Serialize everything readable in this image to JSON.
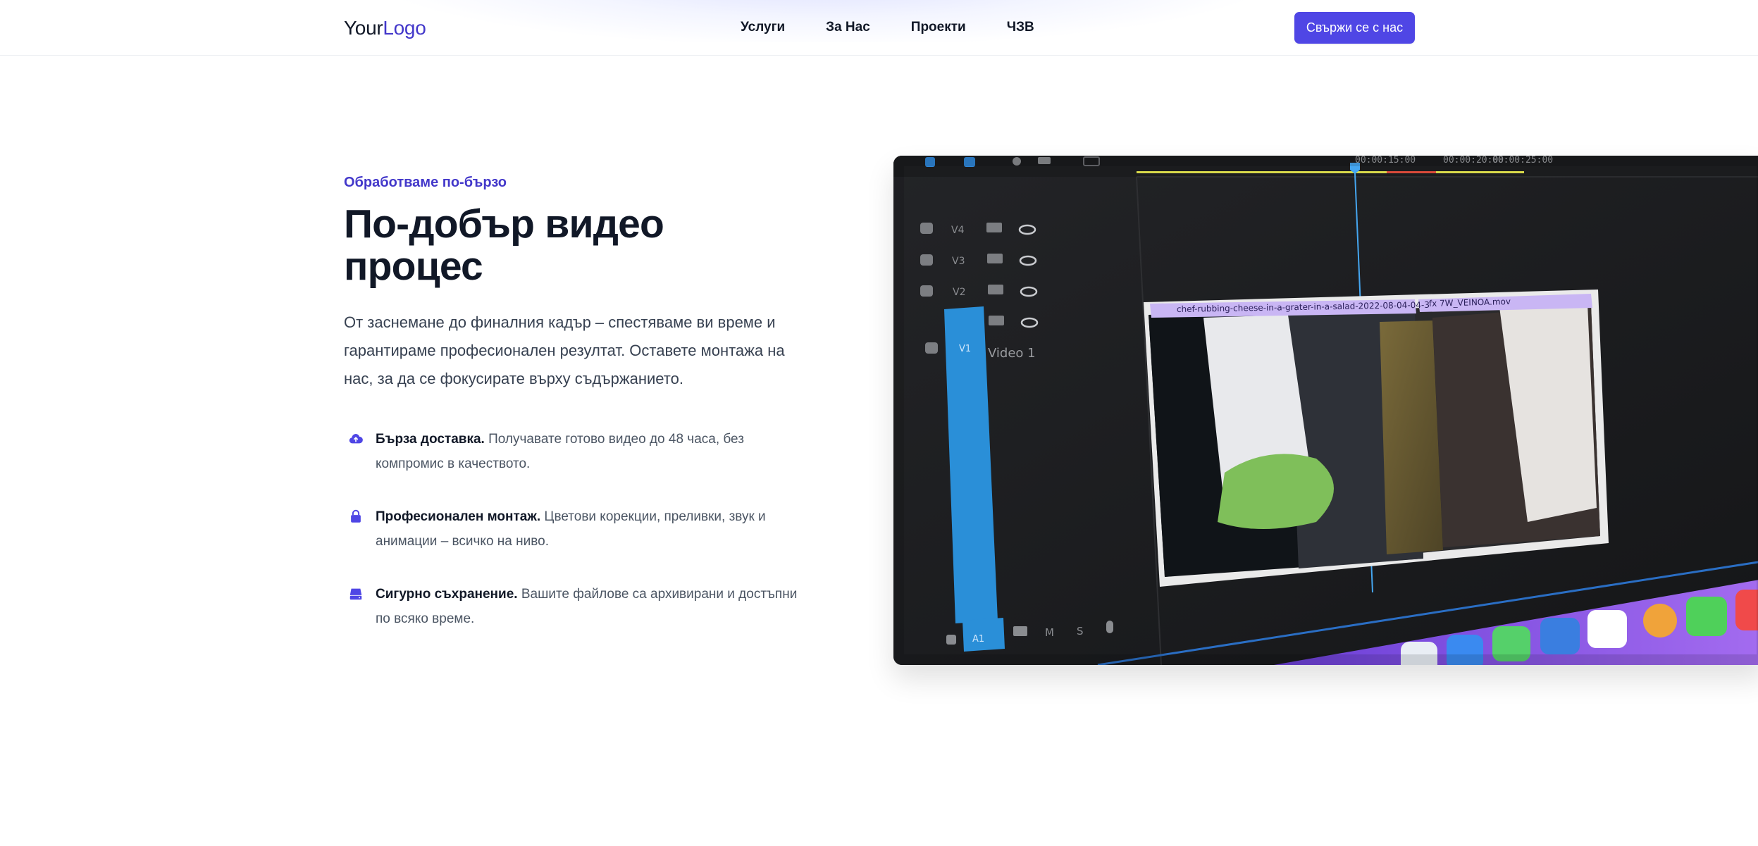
{
  "header": {
    "logo": {
      "part1": "Your",
      "part2": "Logo"
    },
    "nav": [
      "Услуги",
      "За Нас",
      "Проекти",
      "ЧЗВ"
    ],
    "cta_label": "Свържи се с нас"
  },
  "hero": {
    "eyebrow": "Обработваме по-бързо",
    "title": "По-добър видео процес",
    "lead": "От заснемане до финалния кадър – спестяваме ви време и гарантираме професионален резултат. Оставете монтажа на нас, за да се фокусирате върху съдържанието.",
    "features": [
      {
        "icon": "cloud-upload-icon",
        "name": "Бърза доставка.",
        "text": "Получавате готово видео до 48 часа, без компромис в качеството."
      },
      {
        "icon": "lock-icon",
        "name": "Професионален монтаж.",
        "text": "Цветови корекции, преливки, звук и анимации – всичко на ниво."
      },
      {
        "icon": "server-icon",
        "name": "Сигурно съхранение.",
        "text": "Вашите файлове са архивирани и достъпни по всяко време."
      }
    ]
  },
  "media": {
    "timeline_labels": [
      "00:00:15:00",
      "00:00:20:00",
      "00:00:25:00"
    ],
    "tracks": [
      "V4",
      "V3",
      "V2",
      "V1",
      "A1"
    ],
    "track_name": "Video 1",
    "clip_name_1": "chef-rubbing-cheese-in-a-grater-in-a-salad-2022-08-04-04-3",
    "clip_name_2": "fx 7W_VEINOA.mov",
    "colors": {
      "accent": "#4f46e5",
      "accent_text": "#4338ca",
      "track_blue": "#2a8fd8"
    }
  }
}
